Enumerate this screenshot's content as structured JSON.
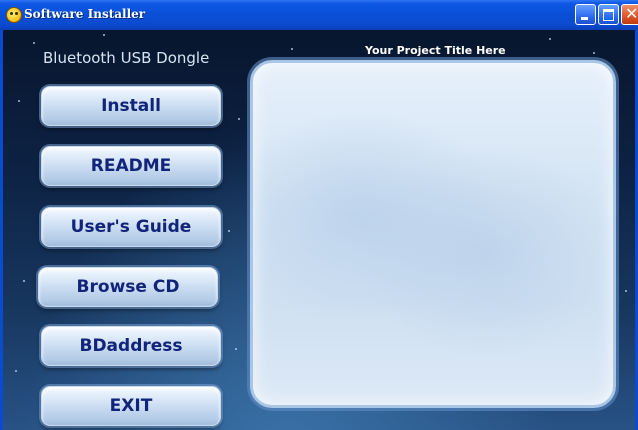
{
  "window": {
    "title": "Software Installer",
    "controls": {
      "close_glyph": "✕"
    }
  },
  "header": {
    "product_name": "Bluetooth USB Dongle",
    "project_title": "Your Project Title Here"
  },
  "menu": {
    "items": [
      {
        "label": "Install"
      },
      {
        "label": "README"
      },
      {
        "label": "User's Guide"
      },
      {
        "label": "Browse CD"
      },
      {
        "label": "BDaddress"
      },
      {
        "label": "EXIT"
      }
    ]
  },
  "colors": {
    "titlebar": "#0b4bd0",
    "button_text": "#12237a",
    "panel_border": "#a9c6e6",
    "background_top": "#08162e",
    "background_bottom": "#285285"
  },
  "icons": {
    "app": "smiley-icon",
    "minimize": "minimize-icon",
    "maximize": "maximize-icon",
    "close": "close-icon"
  }
}
